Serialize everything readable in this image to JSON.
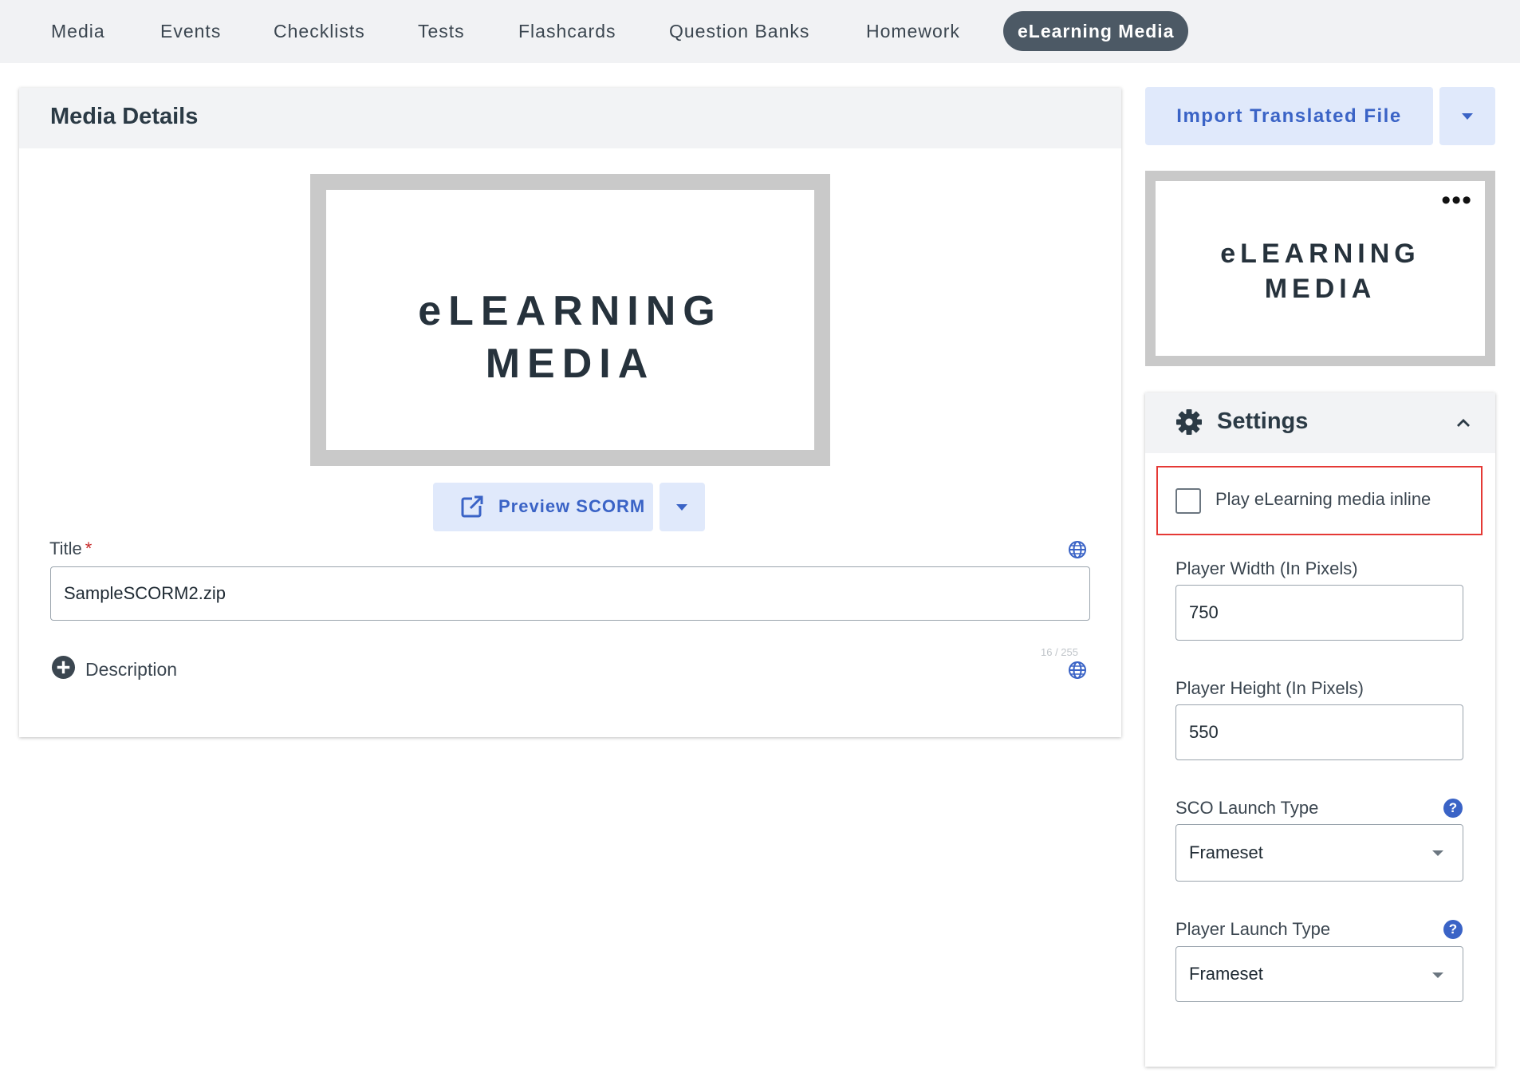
{
  "nav": {
    "items": [
      {
        "label": "Media"
      },
      {
        "label": "Events"
      },
      {
        "label": "Checklists"
      },
      {
        "label": "Tests"
      },
      {
        "label": "Flashcards"
      },
      {
        "label": "Question Banks"
      },
      {
        "label": "Homework"
      },
      {
        "label": "eLearning Media",
        "active": true
      }
    ]
  },
  "media_details": {
    "title": "Media Details",
    "thumbnail": {
      "line1": "eLEARNING",
      "line2": "MEDIA"
    },
    "preview_button": "Preview SCORM",
    "title_field": {
      "label": "Title",
      "required_mark": "*",
      "value": "SampleSCORM2.zip",
      "counter": "16 / 255"
    },
    "description_label": "Description"
  },
  "sidebar": {
    "import_button": "Import Translated File",
    "thumbnail": {
      "line1": "eLEARNING",
      "line2": "MEDIA",
      "menu": "•••"
    },
    "settings": {
      "title": "Settings",
      "play_inline": {
        "label": "Play eLearning media inline",
        "checked": false
      },
      "player_width": {
        "label": "Player Width (In Pixels)",
        "value": "750"
      },
      "player_height": {
        "label": "Player Height (In Pixels)",
        "value": "550"
      },
      "sco_launch_type": {
        "label": "SCO Launch Type",
        "value": "Frameset",
        "help": "?"
      },
      "player_launch_type": {
        "label": "Player Launch Type",
        "value": "Frameset",
        "help": "?"
      }
    }
  },
  "colors": {
    "accent": "#3a63c6",
    "active_tab": "#4c5965",
    "highlight": "#e53935",
    "required": "#c62828"
  }
}
